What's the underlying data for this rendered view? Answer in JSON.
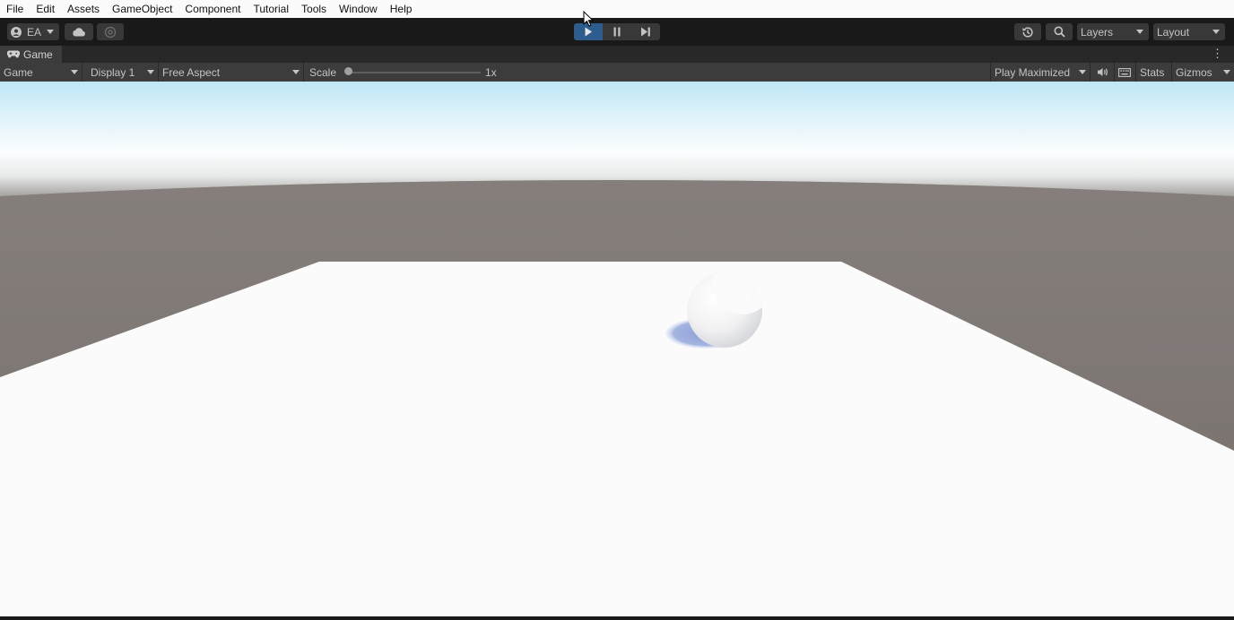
{
  "menubar": {
    "items": [
      "File",
      "Edit",
      "Assets",
      "GameObject",
      "Component",
      "Tutorial",
      "Tools",
      "Window",
      "Help"
    ]
  },
  "toolbar": {
    "account_label": "EA",
    "cloud_icon": "cloud-icon",
    "collab_icon": "collab-icon",
    "play_icon": "play-icon",
    "pause_icon": "pause-icon",
    "step_icon": "step-icon",
    "history_icon": "history-icon",
    "search_icon": "search-icon",
    "layers_label": "Layers",
    "layout_label": "Layout",
    "play_active": true
  },
  "tabbar": {
    "tab_label": "Game",
    "tab_icon": "gamepad-icon",
    "more_label": "⋮"
  },
  "gamebar": {
    "view_label": "Game",
    "display_label": "Display 1",
    "aspect_label": "Free Aspect",
    "scale_label": "Scale",
    "scale_value_label": "1x",
    "scale_position": 0.0,
    "play_mode_label": "Play Maximized",
    "audio_icon": "speaker-icon",
    "grid_icon": "keyboard-icon",
    "stats_label": "Stats",
    "gizmos_label": "Gizmos"
  },
  "scene": {
    "sky_color": "#d9f0fa",
    "ground_color": "#7c7572",
    "plane_color": "#fbfbfc",
    "sphere_color": "#f3f3f3",
    "shadow_color": "#8fa3d6"
  },
  "colors": {
    "accent": "#2d5d8f",
    "toolbar_bg": "#191919",
    "panel_bg": "#3c3c3c"
  }
}
